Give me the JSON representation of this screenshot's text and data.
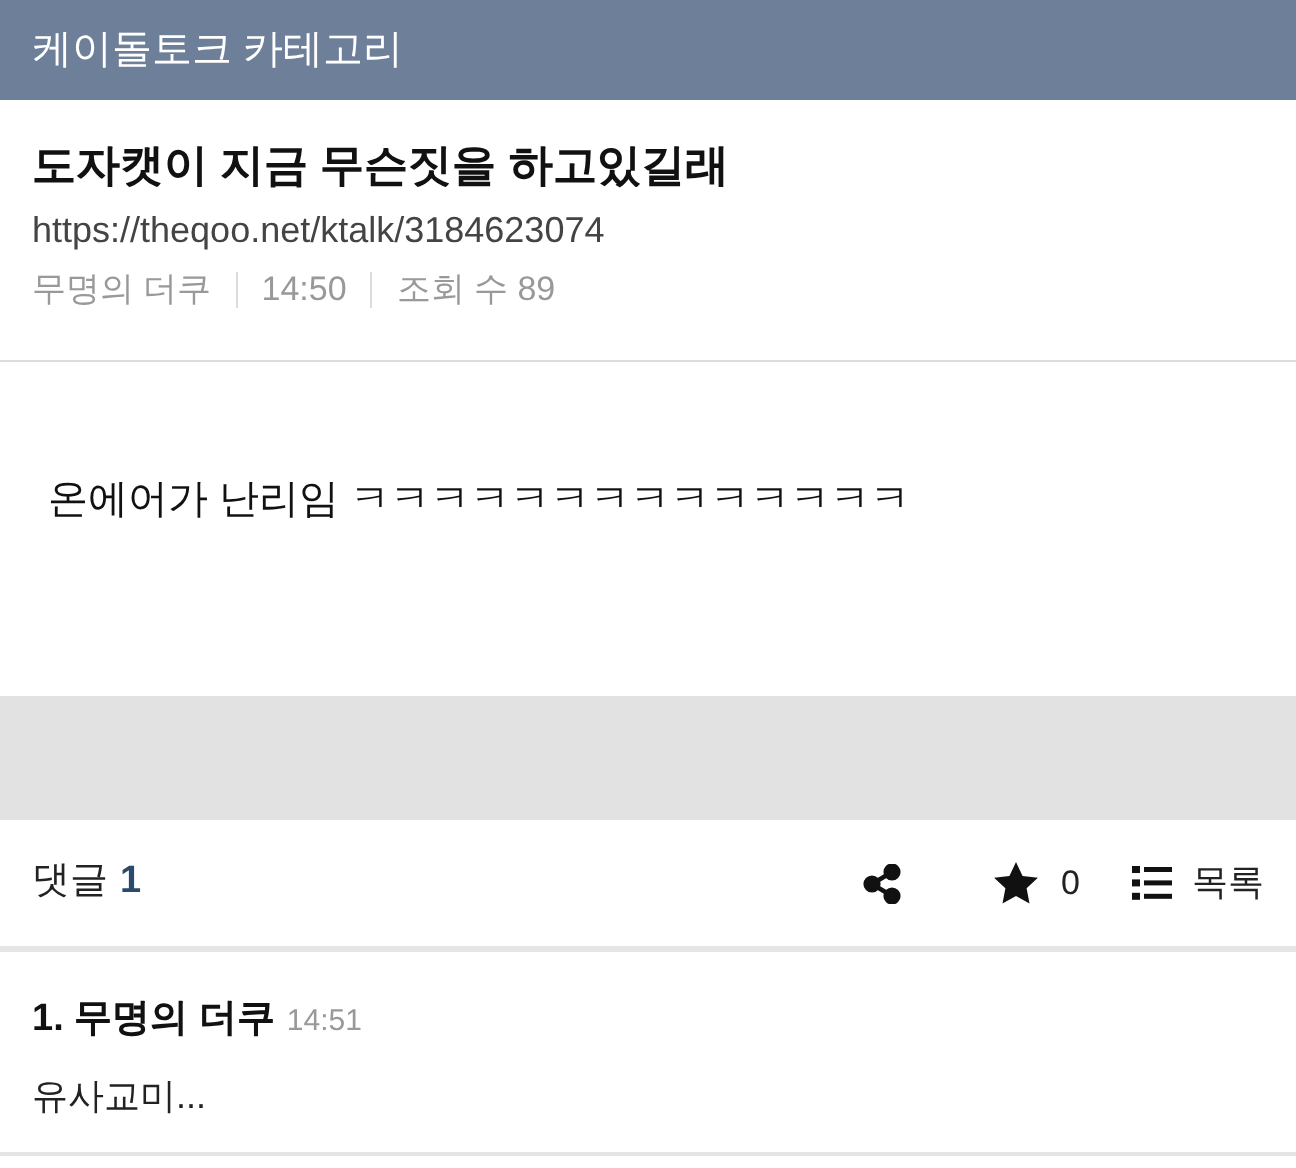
{
  "header": {
    "title": "케이돌토크 카테고리"
  },
  "post": {
    "title": "도자캣이 지금 무슨짓을 하고있길래",
    "url": "https://theqoo.net/ktalk/3184623074",
    "author": "무명의 더쿠",
    "time": "14:50",
    "views": "조회 수 89",
    "body": "온에어가 난리임 ㅋㅋㅋㅋㅋㅋㅋㅋㅋㅋㅋㅋㅋㅋ"
  },
  "toolbar": {
    "comments_label": "댓글",
    "comments_count": "1",
    "star_count": "0",
    "list_label": "목록"
  },
  "comments": [
    {
      "author": "1. 무명의 더쿠",
      "time": "14:51",
      "text": "유사교미..."
    }
  ]
}
